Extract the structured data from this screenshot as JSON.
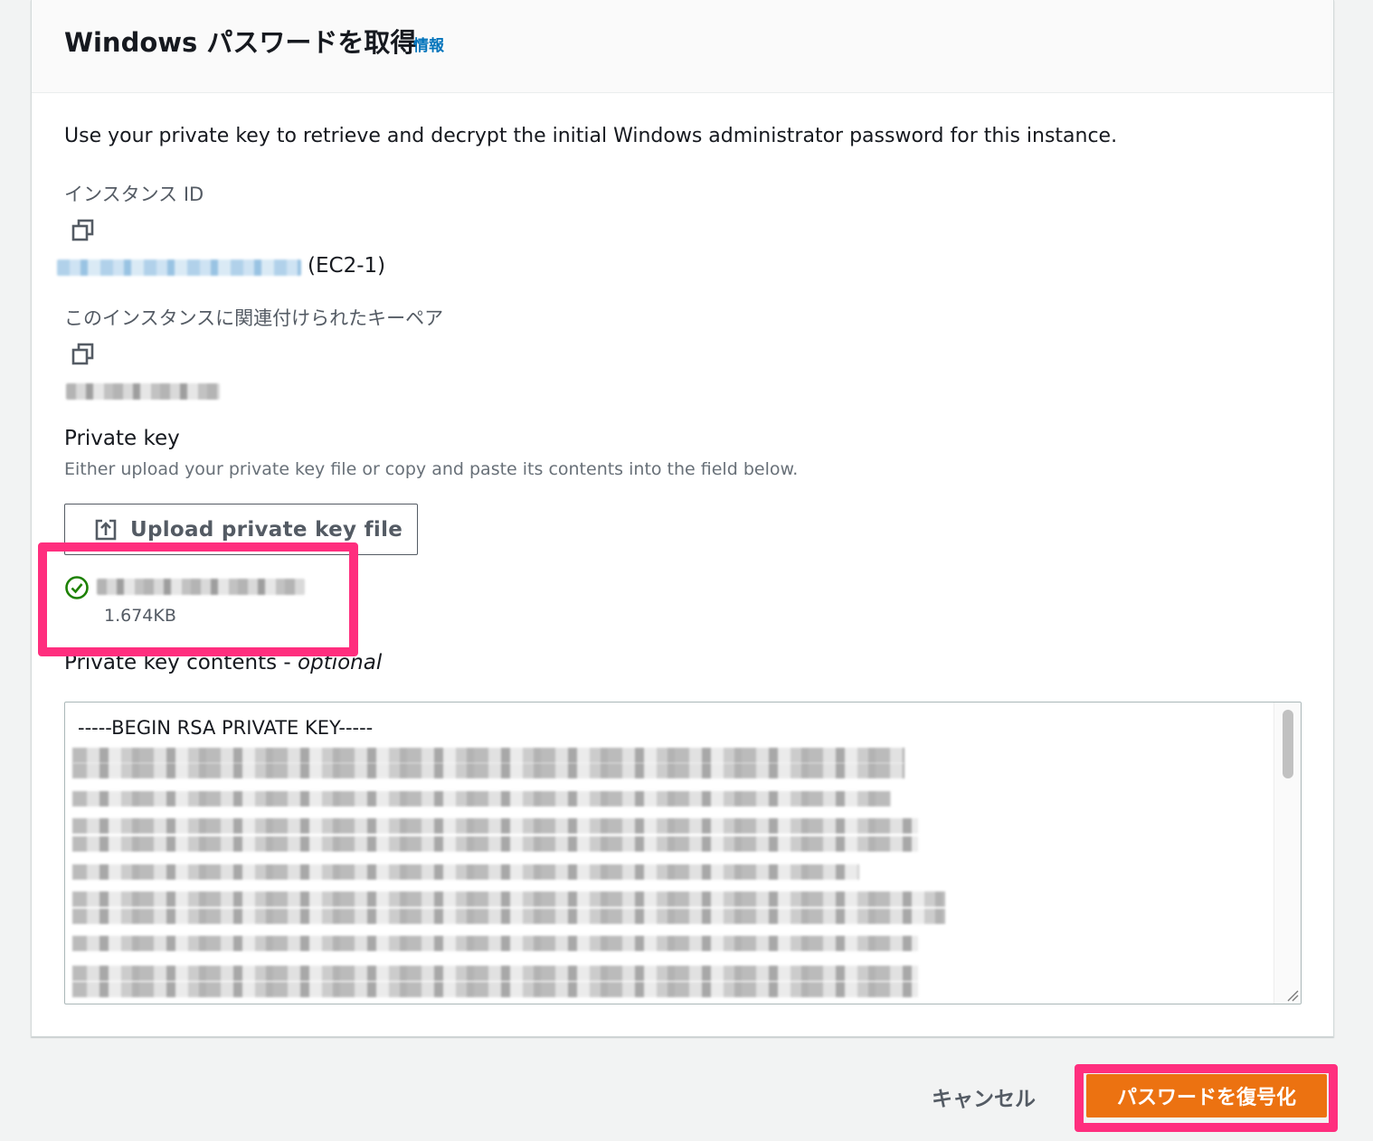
{
  "header": {
    "title": "Windows パスワードを取得",
    "info_link": "情報"
  },
  "description": "Use your private key to retrieve and decrypt the initial Windows administrator password for this instance.",
  "instance": {
    "label": "インスタンス ID",
    "name_suffix": "(EC2-1)"
  },
  "key_pair": {
    "label": "このインスタンスに関連付けられたキーペア"
  },
  "private_key": {
    "label": "Private key",
    "hint": "Either upload your private key file or copy and paste its contents into the field below.",
    "upload_button": "Upload private key file",
    "file_size": "1.674KB"
  },
  "contents": {
    "label": "Private key contents - ",
    "label_optional": "optional",
    "first_line": "-----BEGIN RSA PRIVATE KEY-----"
  },
  "footer": {
    "cancel": "キャンセル",
    "decrypt": "パスワードを復号化"
  },
  "colors": {
    "primary": "#ec7211",
    "link": "#0073bb",
    "highlight": "#ff2e7e",
    "success": "#1d8102"
  }
}
